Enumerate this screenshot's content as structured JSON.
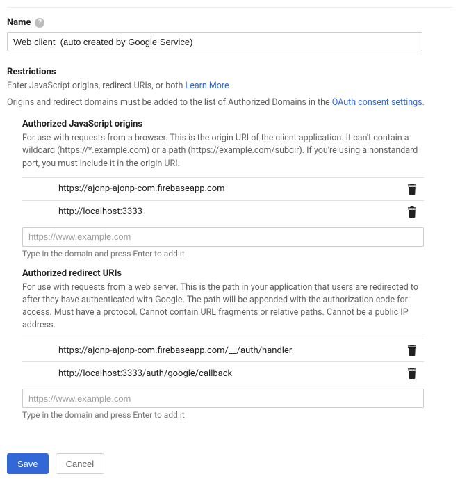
{
  "name": {
    "label": "Name",
    "value": "Web client  (auto created by Google Service)"
  },
  "restrictions": {
    "title": "Restrictions",
    "desc_line1": "Enter JavaScript origins, redirect URIs, or both ",
    "learn_more": "Learn More",
    "desc_line2_a": "Origins and redirect domains must be added to the list of Authorized Domains in the ",
    "consent_link": "OAuth consent settings",
    "desc_line2_b": "."
  },
  "js_origins": {
    "title": "Authorized JavaScript origins",
    "desc": "For use with requests from a browser. This is the origin URI of the client application. It can't contain a wildcard (https://*.example.com) or a path (https://example.com/subdir). If you're using a nonstandard port, you must include it in the origin URI.",
    "items": [
      "https://ajonp-ajonp-com.firebaseapp.com",
      "http://localhost:3333"
    ],
    "placeholder": "https://www.example.com",
    "hint": "Type in the domain and press Enter to add it"
  },
  "redirect_uris": {
    "title": "Authorized redirect URIs",
    "desc": "For use with requests from a web server. This is the path in your application that users are redirected to after they have authenticated with Google. The path will be appended with the authorization code for access. Must have a protocol. Cannot contain URL fragments or relative paths. Cannot be a public IP address.",
    "items": [
      "https://ajonp-ajonp-com.firebaseapp.com/__/auth/handler",
      "http://localhost:3333/auth/google/callback"
    ],
    "placeholder": "https://www.example.com",
    "hint": "Type in the domain and press Enter to add it"
  },
  "buttons": {
    "save": "Save",
    "cancel": "Cancel"
  }
}
